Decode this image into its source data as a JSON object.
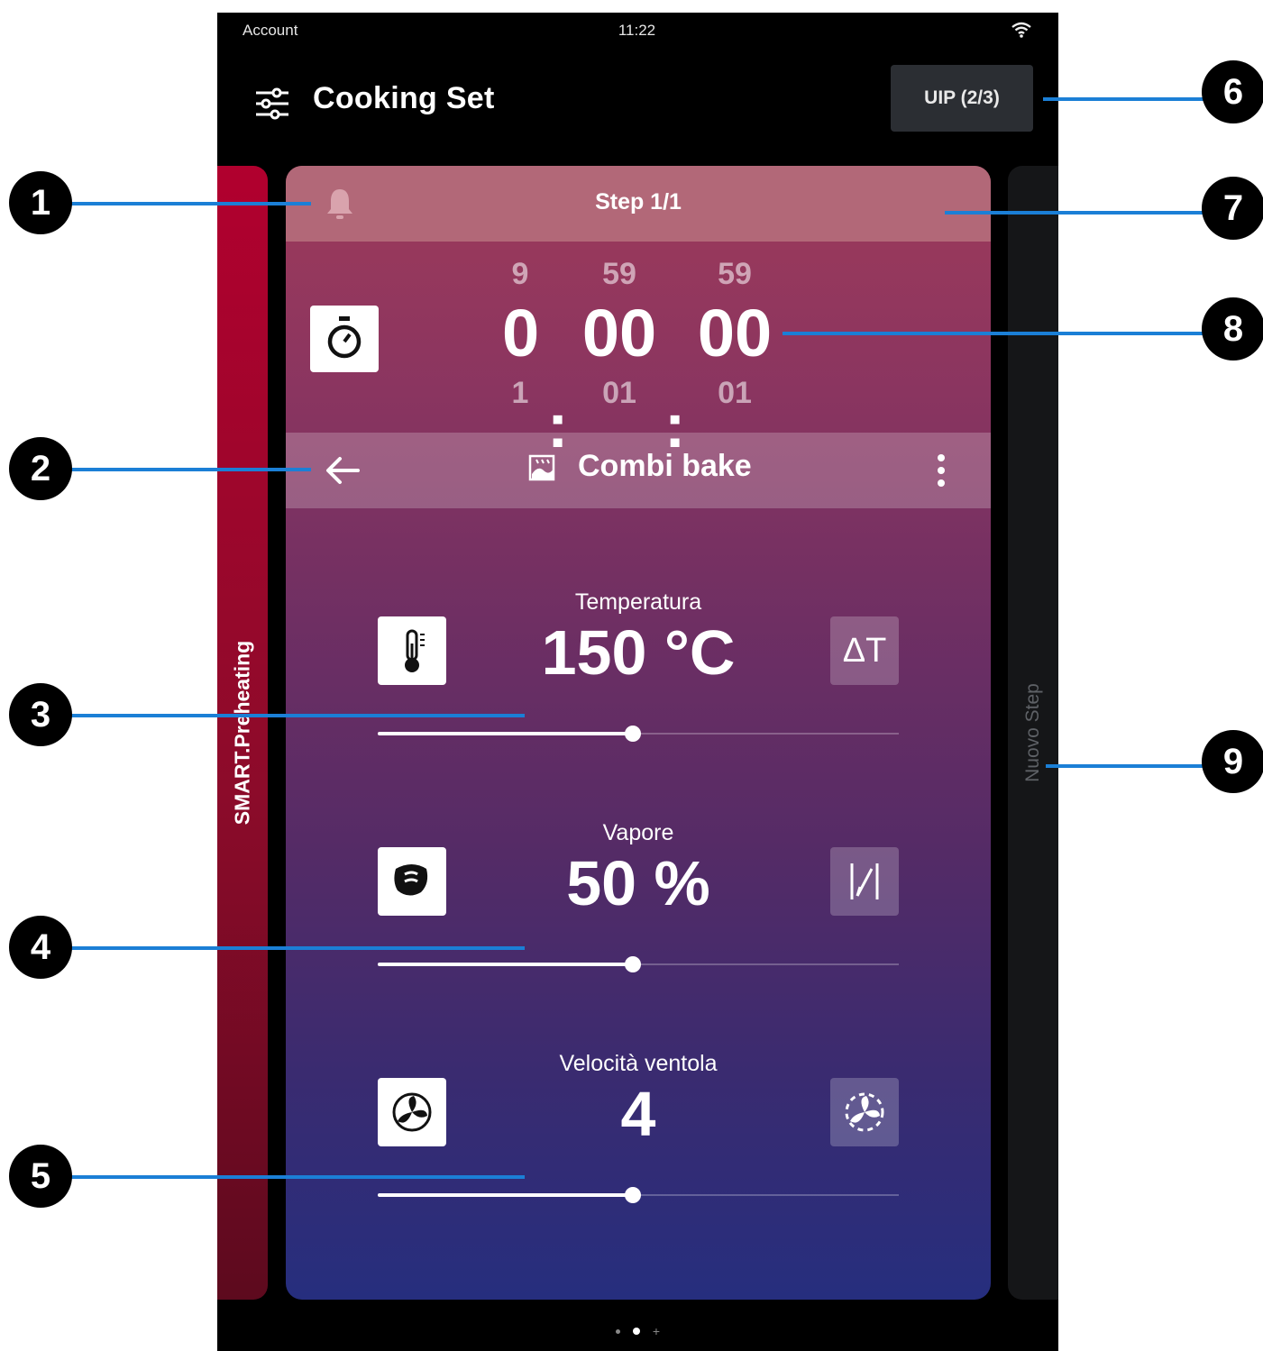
{
  "status_bar": {
    "account": "Account",
    "time": "11:22",
    "wifi_icon": "wifi-icon"
  },
  "app_bar": {
    "menu_icon": "sliders-icon",
    "title": "Cooking Set",
    "uip_button": "UIP (2/3)"
  },
  "left_panel": {
    "label": "SMART.Preheating"
  },
  "right_panel": {
    "label": "Nuovo Step"
  },
  "step_bar": {
    "bell_icon": "bell-icon",
    "label": "Step 1/1"
  },
  "timer": {
    "icon": "stopwatch-icon",
    "above": [
      "9",
      "59",
      "59"
    ],
    "current": [
      "0",
      "00",
      "00"
    ],
    "below": [
      "1",
      "01",
      "01"
    ],
    "separator": ":"
  },
  "mode_bar": {
    "back_icon": "arrow-left-icon",
    "mode_icon": "combi-bake-icon",
    "mode": "Combi bake",
    "more_icon": "more-vertical-icon"
  },
  "parameters": [
    {
      "label": "Temperatura",
      "value": "150 °C",
      "left_icon": "thermometer-icon",
      "right_label": "ΔT",
      "slider_fraction": 0.49
    },
    {
      "label": "Vapore",
      "value": "50 %",
      "left_icon": "steam-icon",
      "right_icon": "humidity-control-icon",
      "slider_fraction": 0.49
    },
    {
      "label": "Velocità ventola",
      "value": "4",
      "left_icon": "fan-icon",
      "right_icon": "fan-pulse-icon",
      "slider_fraction": 0.49
    }
  ],
  "page_dots": {
    "count": 2,
    "active": 1,
    "add_symbol": "+"
  },
  "callouts": [
    "1",
    "2",
    "3",
    "4",
    "5",
    "6",
    "7",
    "8",
    "9"
  ],
  "colors": {
    "callout_line": "#1b7fd6",
    "preheat_panel": "#b1002e",
    "step_bar": "#b26878"
  }
}
